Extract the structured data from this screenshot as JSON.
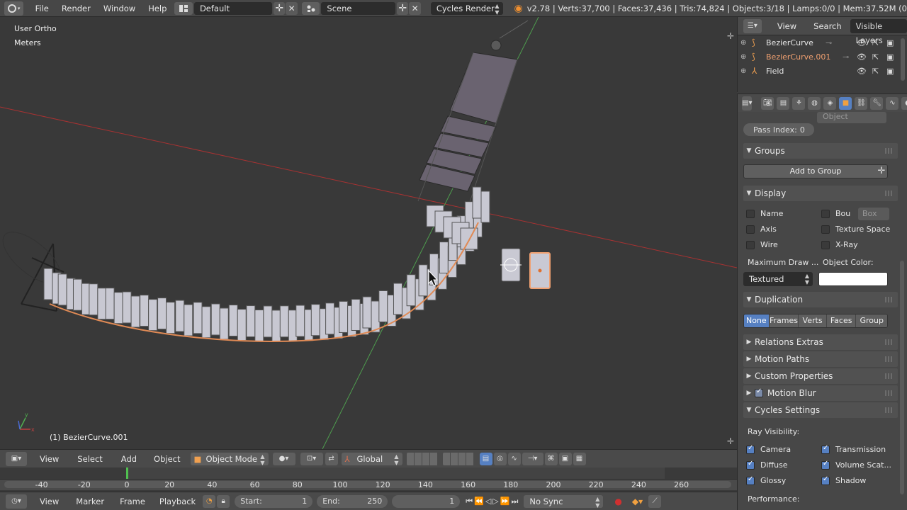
{
  "topbar": {
    "menus": [
      "File",
      "Render",
      "Window",
      "Help"
    ],
    "screen_layout": "Default",
    "scene": "Scene",
    "render_engine": "Cycles Render",
    "stats": "v2.78 | Verts:37,700 | Faces:37,436 | Tris:74,824 | Objects:3/18 | Lamps:0/0 | Mem:37.52M (0"
  },
  "viewport": {
    "view_name": "User Ortho",
    "units": "Meters",
    "active_object": "(1) BezierCurve.001"
  },
  "view3d_header": {
    "menus": [
      "View",
      "Select",
      "Add",
      "Object"
    ],
    "mode": "Object Mode",
    "orientation": "Global"
  },
  "timeline": {
    "ticks": [
      "-40",
      "-20",
      "0",
      "20",
      "40",
      "60",
      "80",
      "100",
      "120",
      "140",
      "160",
      "180",
      "200",
      "220",
      "240",
      "260"
    ],
    "menus": [
      "View",
      "Marker",
      "Frame",
      "Playback"
    ],
    "start_label": "Start:",
    "start_value": "1",
    "end_label": "End:",
    "end_value": "250",
    "current_frame": "1",
    "sync": "No Sync"
  },
  "outliner": {
    "menus": [
      "View",
      "Search"
    ],
    "filter": "Visible Layers",
    "items": [
      {
        "name": "BezierCurve",
        "color": "#e6e6e6"
      },
      {
        "name": "BezierCurve.001",
        "color": "#f0a070"
      },
      {
        "name": "Field",
        "color": "#e6e6e6"
      }
    ]
  },
  "properties": {
    "pass_index_label": "Pass Index:",
    "pass_index_value": "0",
    "object_dropdown": "Object",
    "groups": {
      "title": "Groups",
      "add_button": "Add to Group"
    },
    "display": {
      "title": "Display",
      "name": "Name",
      "bounds": "Bou",
      "bounds_type": "Box",
      "axis": "Axis",
      "texture_space": "Texture Space",
      "wire": "Wire",
      "xray": "X-Ray",
      "max_draw_label": "Maximum Draw ...",
      "object_color_label": "Object Color:",
      "draw_type": "Textured"
    },
    "duplication": {
      "title": "Duplication",
      "options": [
        "None",
        "Frames",
        "Verts",
        "Faces",
        "Group"
      ]
    },
    "collapsed_panels": [
      "Relations Extras",
      "Motion Paths",
      "Custom Properties",
      "Motion Blur"
    ],
    "cycles": {
      "title": "Cycles Settings",
      "ray_visibility": "Ray Visibility:",
      "camera": "Camera",
      "transmission": "Transmission",
      "diffuse": "Diffuse",
      "volume_scatter": "Volume Scat...",
      "glossy": "Glossy",
      "shadow": "Shadow",
      "performance": "Performance:"
    }
  },
  "colors": {
    "accent": "#5680c2",
    "selection": "#f0a070",
    "x_axis": "#b03030",
    "y_axis": "#50a050"
  }
}
